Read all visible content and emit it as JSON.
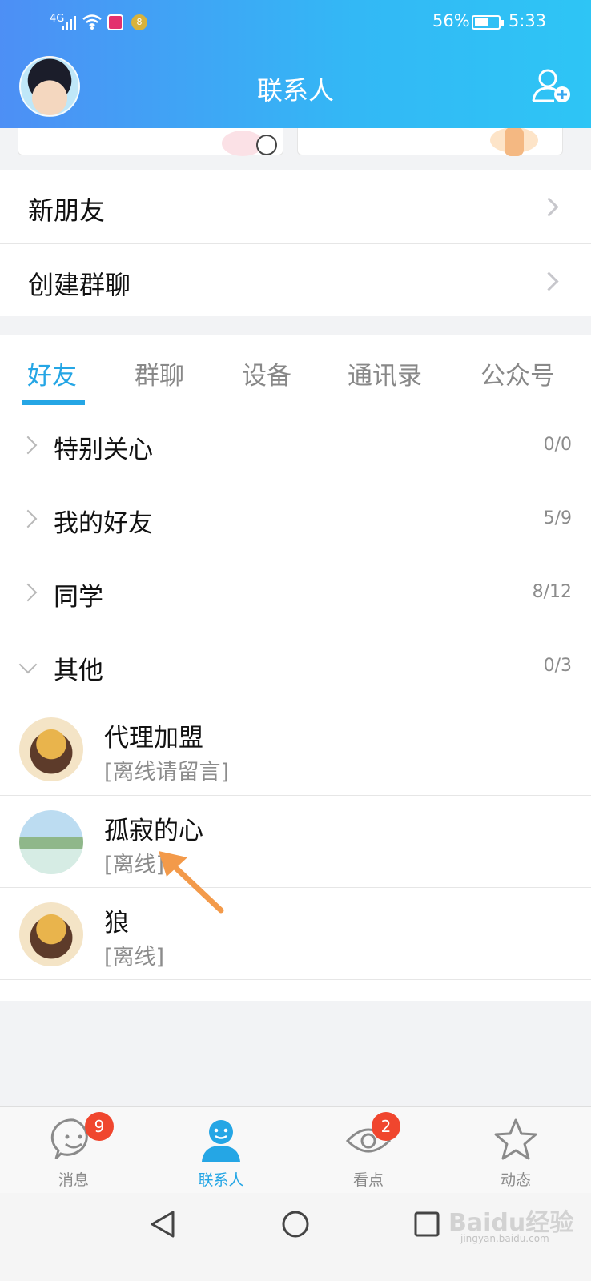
{
  "status_bar": {
    "network": "4G",
    "battery_percent": "56%",
    "battery_level": 0.56,
    "time": "5:33",
    "app_badge": "8"
  },
  "header": {
    "title": "联系人",
    "add_icon": "add-contact-icon"
  },
  "quick_actions": [
    {
      "label": "新朋友"
    },
    {
      "label": "创建群聊"
    }
  ],
  "tabs": [
    {
      "label": "好友",
      "active": true
    },
    {
      "label": "群聊",
      "active": false
    },
    {
      "label": "设备",
      "active": false
    },
    {
      "label": "通讯录",
      "active": false
    },
    {
      "label": "公众号",
      "active": false
    }
  ],
  "groups": [
    {
      "label": "特别关心",
      "count": "0/0",
      "expanded": false
    },
    {
      "label": "我的好友",
      "count": "5/9",
      "expanded": false
    },
    {
      "label": "同学",
      "count": "8/12",
      "expanded": false
    },
    {
      "label": "其他",
      "count": "0/3",
      "expanded": true
    }
  ],
  "friends": [
    {
      "name": "代理加盟",
      "status": "[离线请留言]"
    },
    {
      "name": "孤寂的心",
      "status": "[离线]"
    },
    {
      "name": "狼",
      "status": "[离线]"
    }
  ],
  "bottom_nav": [
    {
      "label": "消息",
      "icon": "message-icon",
      "badge": "9"
    },
    {
      "label": "联系人",
      "icon": "contacts-icon",
      "active": true
    },
    {
      "label": "看点",
      "icon": "eye-icon",
      "badge": "2"
    },
    {
      "label": "动态",
      "icon": "star-icon"
    }
  ],
  "watermark": {
    "text": "Baidu经验",
    "sub": "jingyan.baidu.com"
  },
  "colors": {
    "accent": "#25a6e5",
    "badge": "#f0462e",
    "header_start": "#4d8ff5",
    "header_end": "#2ec5f5",
    "annotation_arrow": "#f39a4a"
  }
}
